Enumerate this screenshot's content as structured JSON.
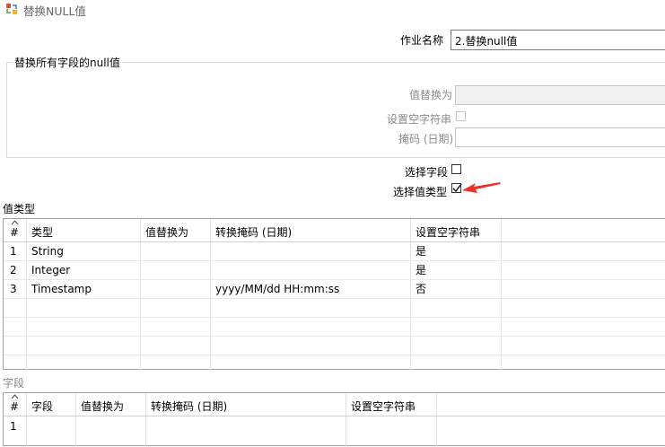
{
  "window": {
    "title": "替换NULL值",
    "icon": "replace-null-icon"
  },
  "job_name": {
    "label": "作业名称",
    "value": "2.替换null值"
  },
  "group": {
    "title": "替换所有字段的null值",
    "replace_label": "值替换为",
    "replace_value": "",
    "empty_string_label": "设置空字符串",
    "mask_label": "掩码 (日期)",
    "mask_value": ""
  },
  "select_field": {
    "label": "选择字段",
    "checked": false
  },
  "select_type": {
    "label": "选择值类型",
    "checked": true
  },
  "value_types": {
    "title": "值类型",
    "columns": [
      "#",
      "类型",
      "值替换为",
      "转换掩码 (日期)",
      "设置空字符串"
    ],
    "rows": [
      [
        "1",
        "String",
        "",
        "",
        "是"
      ],
      [
        "2",
        "Integer",
        "",
        "",
        "是"
      ],
      [
        "3",
        "Timestamp",
        "",
        "yyyy/MM/dd HH:mm:ss",
        "否"
      ]
    ]
  },
  "fields": {
    "title": "字段",
    "columns": [
      "#",
      "字段",
      "值替换为",
      "转换掩码 (日期)",
      "设置空字符串"
    ],
    "rows": [
      [
        "1",
        "",
        "",
        "",
        ""
      ]
    ]
  },
  "colors": {
    "annotation_arrow": "#e8322b",
    "grid_line": "#e3e3e3",
    "border": "#a0a0a0"
  }
}
